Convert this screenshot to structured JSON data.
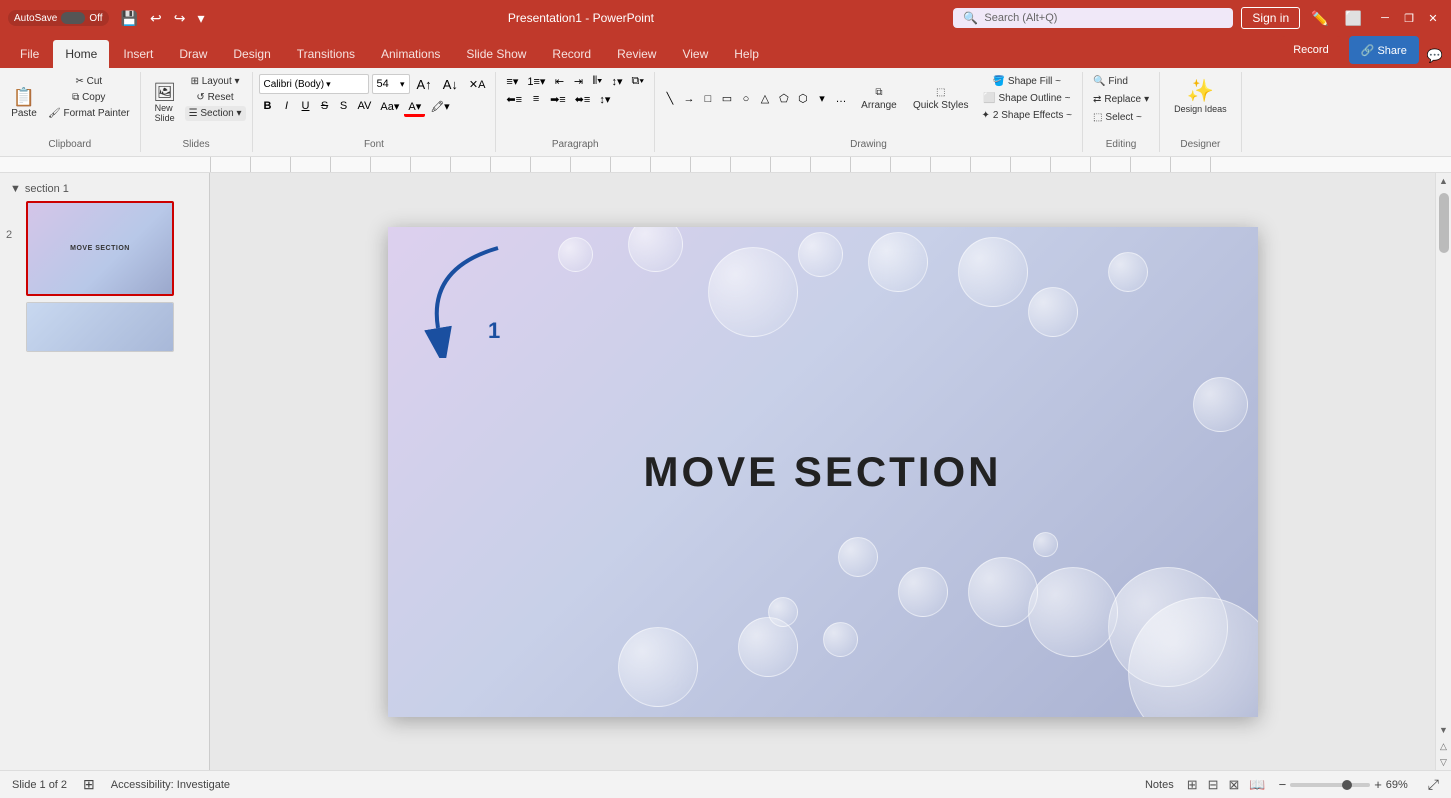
{
  "titleBar": {
    "autosave": "AutoSave",
    "toggleState": "Off",
    "title": "Presentation1 - PowerPoint",
    "search": "Search (Alt+Q)",
    "signIn": "Sign in",
    "minimize": "─",
    "restore": "❐",
    "close": "✕"
  },
  "ribbon": {
    "tabs": [
      "File",
      "Home",
      "Insert",
      "Draw",
      "Design",
      "Transitions",
      "Animations",
      "Slide Show",
      "Record",
      "Review",
      "View",
      "Help"
    ],
    "activeTab": "Home",
    "groups": {
      "clipboard": {
        "label": "Clipboard",
        "paste": "Paste",
        "cut": "Cut",
        "copy": "Copy",
        "formatPainter": "Format Painter"
      },
      "slides": {
        "label": "Slides",
        "layout": "Layout",
        "reset": "Reset",
        "newSlide": "New Slide",
        "section": "Section"
      },
      "font": {
        "label": "Font",
        "fontName": "Calibri (Body)",
        "fontSize": "54",
        "bold": "B",
        "italic": "I",
        "underline": "U",
        "strikethrough": "S"
      },
      "paragraph": {
        "label": "Paragraph"
      },
      "drawing": {
        "label": "Drawing",
        "arrange": "Arrange",
        "quickStyles": "Quick Styles"
      },
      "editing": {
        "label": "Editing",
        "find": "Find",
        "replace": "Replace",
        "select": "Select"
      },
      "designer": {
        "label": "Designer",
        "designIdeas": "Design Ideas"
      }
    },
    "shapeFill": "Shape Fill ~",
    "shapeOutline": "Shape Outline ~",
    "shapeEffects": "2 Shape Effects ~",
    "selectDropdown": "Select ~",
    "recordBtn": "Record",
    "shareBtn": "Share"
  },
  "slidePanel": {
    "sectionLabel": "section 1",
    "slide1Number": "2",
    "slide1ThumbText": "MOVE SECTION",
    "slide2ThumbText": ""
  },
  "canvas": {
    "slideTitle": "MOVE SECTION"
  },
  "statusBar": {
    "slideInfo": "Slide 1 of 2",
    "accessibility": "Accessibility: Investigate",
    "notes": "Notes",
    "zoom": "69%"
  }
}
